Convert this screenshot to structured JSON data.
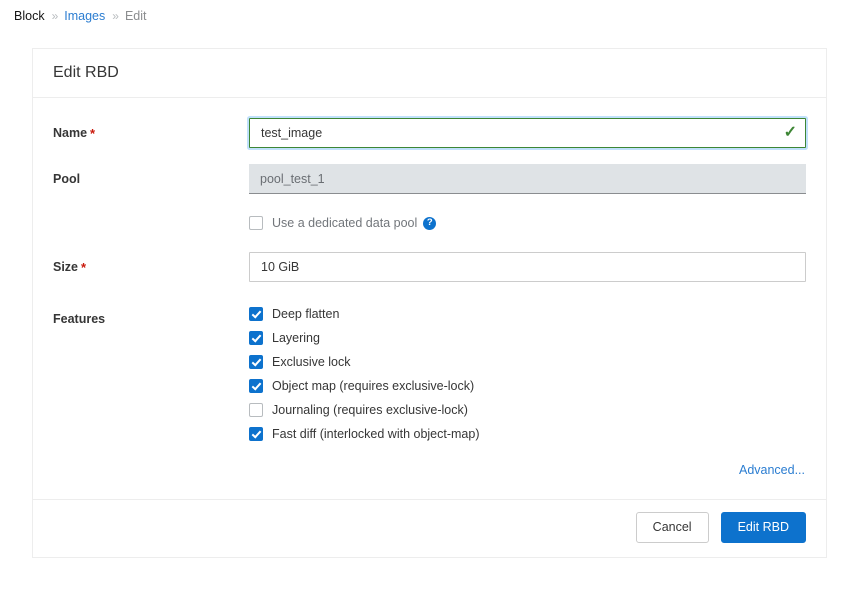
{
  "breadcrumb": {
    "separator": "»",
    "items": [
      {
        "label": "Block",
        "type": "static"
      },
      {
        "label": "Images",
        "type": "link"
      },
      {
        "label": "Edit",
        "type": "current"
      }
    ]
  },
  "dialog": {
    "title": "Edit RBD",
    "fields": {
      "name": {
        "label": "Name",
        "required_marker": "*",
        "value": "test_image",
        "placeholder": "",
        "state": "valid",
        "valid_icon": "check-icon"
      },
      "pool": {
        "label": "Pool",
        "value": "pool_test_1",
        "readonly": true
      },
      "dedicated_data_pool": {
        "label": "Use a dedicated data pool",
        "checked": false,
        "help_icon": "help-icon",
        "help_glyph": "?"
      },
      "size": {
        "label": "Size",
        "required_marker": "*",
        "value": "10 GiB",
        "placeholder": ""
      },
      "features": {
        "label": "Features",
        "items": [
          {
            "label": "Deep flatten",
            "checked": true
          },
          {
            "label": "Layering",
            "checked": true
          },
          {
            "label": "Exclusive lock",
            "checked": true
          },
          {
            "label": "Object map (requires exclusive-lock)",
            "checked": true
          },
          {
            "label": "Journaling (requires exclusive-lock)",
            "checked": false
          },
          {
            "label": "Fast diff (interlocked with object-map)",
            "checked": true
          }
        ]
      }
    },
    "advanced_link": "Advanced...",
    "footer": {
      "cancel_label": "Cancel",
      "submit_label": "Edit RBD"
    }
  },
  "colors": {
    "accent_blue": "#0d72cd",
    "link_blue": "#2b7dd1",
    "valid_green": "#3e8635",
    "required_red": "#c9190b",
    "readonly_bg": "#dfe3e6",
    "border_gray": "#ededed"
  }
}
